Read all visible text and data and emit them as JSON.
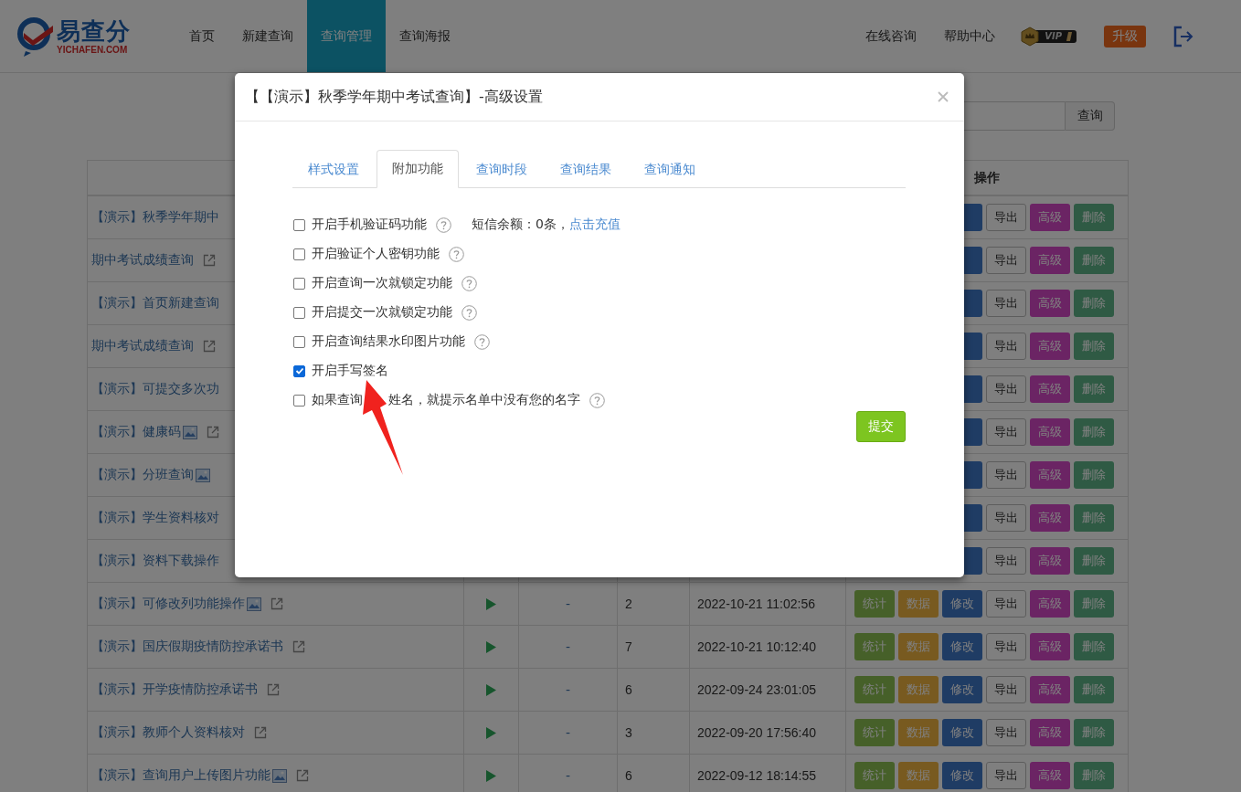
{
  "header": {
    "logo": {
      "text": "易查分",
      "subtext": "YICHAFEN.COM"
    },
    "nav": [
      {
        "label": "首页",
        "selected": false
      },
      {
        "label": "新建查询",
        "selected": false
      },
      {
        "label": "查询管理",
        "selected": true
      },
      {
        "label": "查询海报",
        "selected": false
      }
    ],
    "links": [
      "在线咨询",
      "帮助中心"
    ],
    "vip_badge": "VIP",
    "upgrade_button": "升级"
  },
  "search": {
    "button": "查询"
  },
  "table": {
    "action_heading": "操作",
    "rows": [
      {
        "name": "【演示】秋季学年期中",
        "actions": [
          {
            "kind": "edit"
          },
          {
            "kind": "export",
            "label": "导出"
          },
          {
            "kind": "advanced",
            "label": "高级"
          },
          {
            "kind": "delete",
            "label": "删除"
          }
        ]
      },
      {
        "name": "期中考试成绩查询",
        "link_icon": true,
        "actions": [
          {
            "kind": "edit"
          },
          {
            "kind": "export",
            "label": "导出"
          },
          {
            "kind": "advanced",
            "label": "高级"
          },
          {
            "kind": "delete",
            "label": "删除"
          }
        ]
      },
      {
        "name": "【演示】首页新建查询",
        "actions": [
          {
            "kind": "edit"
          },
          {
            "kind": "export",
            "label": "导出"
          },
          {
            "kind": "advanced",
            "label": "高级"
          },
          {
            "kind": "delete",
            "label": "删除"
          }
        ]
      },
      {
        "name": "期中考试成绩查询",
        "link_icon": true,
        "actions": [
          {
            "kind": "edit"
          },
          {
            "kind": "export",
            "label": "导出"
          },
          {
            "kind": "advanced",
            "label": "高级"
          },
          {
            "kind": "delete",
            "label": "删除"
          }
        ]
      },
      {
        "name": "【演示】可提交多次功",
        "actions": [
          {
            "kind": "edit"
          },
          {
            "kind": "export",
            "label": "导出"
          },
          {
            "kind": "advanced",
            "label": "高级"
          },
          {
            "kind": "delete",
            "label": "删除"
          }
        ]
      },
      {
        "name": "【演示】健康码",
        "picture_icon": true,
        "link_icon": true,
        "actions": [
          {
            "kind": "edit"
          },
          {
            "kind": "export",
            "label": "导出"
          },
          {
            "kind": "advanced",
            "label": "高级"
          },
          {
            "kind": "delete",
            "label": "删除"
          }
        ]
      },
      {
        "name": "【演示】分班查询",
        "picture_icon": true,
        "actions": [
          {
            "kind": "edit"
          },
          {
            "kind": "export",
            "label": "导出"
          },
          {
            "kind": "advanced",
            "label": "高级"
          },
          {
            "kind": "delete",
            "label": "删除"
          }
        ]
      },
      {
        "name": "【演示】学生资料核对",
        "actions": [
          {
            "kind": "edit"
          },
          {
            "kind": "export",
            "label": "导出"
          },
          {
            "kind": "advanced",
            "label": "高级"
          },
          {
            "kind": "delete",
            "label": "删除"
          }
        ]
      },
      {
        "name": "【演示】资料下载操作",
        "actions": [
          {
            "kind": "edit"
          },
          {
            "kind": "export",
            "label": "导出"
          },
          {
            "kind": "advanced",
            "label": "高级"
          },
          {
            "kind": "delete",
            "label": "删除"
          }
        ]
      },
      {
        "name": "【演示】可修改列功能操作",
        "picture_icon": true,
        "link_icon": true,
        "status": "-",
        "count": "2",
        "date": "2022-10-21 11:02:56",
        "actions": [
          {
            "kind": "stats",
            "label": "统计"
          },
          {
            "kind": "data",
            "label": "数据"
          },
          {
            "kind": "edit",
            "label": "修改"
          },
          {
            "kind": "export",
            "label": "导出"
          },
          {
            "kind": "advanced",
            "label": "高级"
          },
          {
            "kind": "delete",
            "label": "删除"
          }
        ]
      },
      {
        "name": "【演示】国庆假期疫情防控承诺书",
        "link_icon": true,
        "status": "-",
        "count": "7",
        "date": "2022-10-21 10:12:40",
        "actions": [
          {
            "kind": "stats",
            "label": "统计"
          },
          {
            "kind": "data",
            "label": "数据"
          },
          {
            "kind": "edit",
            "label": "修改"
          },
          {
            "kind": "export",
            "label": "导出"
          },
          {
            "kind": "advanced",
            "label": "高级"
          },
          {
            "kind": "delete",
            "label": "删除"
          }
        ]
      },
      {
        "name": "【演示】开学疫情防控承诺书",
        "link_icon": true,
        "status": "-",
        "count": "6",
        "date": "2022-09-24 23:01:05",
        "actions": [
          {
            "kind": "stats",
            "label": "统计"
          },
          {
            "kind": "data",
            "label": "数据"
          },
          {
            "kind": "edit",
            "label": "修改"
          },
          {
            "kind": "export",
            "label": "导出"
          },
          {
            "kind": "advanced",
            "label": "高级"
          },
          {
            "kind": "delete",
            "label": "删除"
          }
        ]
      },
      {
        "name": "【演示】教师个人资料核对",
        "link_icon": true,
        "status": "-",
        "count": "3",
        "date": "2022-09-20 17:56:40",
        "actions": [
          {
            "kind": "stats",
            "label": "统计"
          },
          {
            "kind": "data",
            "label": "数据"
          },
          {
            "kind": "edit",
            "label": "修改"
          },
          {
            "kind": "export",
            "label": "导出"
          },
          {
            "kind": "advanced",
            "label": "高级"
          },
          {
            "kind": "delete",
            "label": "删除"
          }
        ]
      },
      {
        "name": "【演示】查询用户上传图片功能",
        "picture_icon": true,
        "link_icon": true,
        "status": "-",
        "count": "6",
        "date": "2022-09-12 18:14:55",
        "actions": [
          {
            "kind": "stats",
            "label": "统计"
          },
          {
            "kind": "data",
            "label": "数据"
          },
          {
            "kind": "edit",
            "label": "修改"
          },
          {
            "kind": "export",
            "label": "导出"
          },
          {
            "kind": "advanced",
            "label": "高级"
          },
          {
            "kind": "delete",
            "label": "删除"
          }
        ]
      }
    ]
  },
  "dialog": {
    "title": "【【演示】秋季学年期中考试查询】-高级设置",
    "tabs": [
      {
        "label": "样式设置",
        "selected": false
      },
      {
        "label": "附加功能",
        "selected": true
      },
      {
        "label": "查询时段",
        "selected": false
      },
      {
        "label": "查询结果",
        "selected": false
      },
      {
        "label": "查询通知",
        "selected": false
      }
    ],
    "options": [
      {
        "label": "开启手机验证码功能",
        "checked": false,
        "help": true,
        "note": "短信余额：0条，",
        "link": "点击充值"
      },
      {
        "label": "开启验证个人密钥功能",
        "checked": false,
        "help": true
      },
      {
        "label": "开启查询一次就锁定功能",
        "checked": false,
        "help": true
      },
      {
        "label": "开启提交一次就锁定功能",
        "checked": false,
        "help": true
      },
      {
        "label": "开启查询结果水印图片功能",
        "checked": false,
        "help": true
      },
      {
        "label": "开启手写签名",
        "checked": true
      },
      {
        "label": "如果查询",
        "label_end": "姓名，就提示名单中没有您的名字",
        "checked": false,
        "help": true
      }
    ],
    "submit": "提交"
  }
}
